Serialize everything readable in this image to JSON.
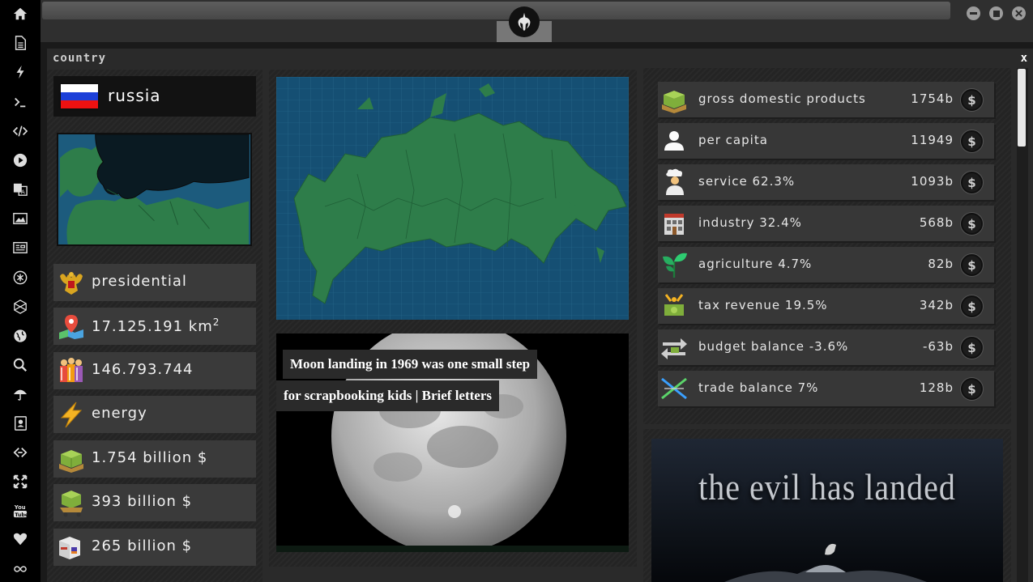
{
  "window": {
    "title": "country",
    "close": "x"
  },
  "country": {
    "name": "russia"
  },
  "profile": [
    {
      "name": "government",
      "icon": "coat-of-arms-icon",
      "value": "presidential"
    },
    {
      "name": "area",
      "icon": "map-pin-icon",
      "value": "17.125.191 km",
      "sup": "2"
    },
    {
      "name": "population",
      "icon": "population-icon",
      "value": "146.793.744"
    },
    {
      "name": "resource",
      "icon": "lightning-icon",
      "value": "energy"
    },
    {
      "name": "gdp-total",
      "icon": "money-stack-icon",
      "value": "1.754 billion $"
    },
    {
      "name": "budget-total",
      "icon": "money-cart-icon",
      "value": "393 billion $"
    },
    {
      "name": "trade-total",
      "icon": "cargo-boxes-icon",
      "value": "265 billion $"
    }
  ],
  "economy": [
    {
      "label": "gross domestic products",
      "value": "1754b",
      "icon": "money-stack-icon"
    },
    {
      "label": "per capita",
      "value": "11949",
      "icon": "person-icon"
    },
    {
      "label": "service 62.3%",
      "value": "1093b",
      "icon": "chef-icon"
    },
    {
      "label": "industry 32.4%",
      "value": "568b",
      "icon": "factory-icon"
    },
    {
      "label": "agriculture 4.7%",
      "value": "82b",
      "icon": "sprout-icon"
    },
    {
      "label": "tax revenue 19.5%",
      "value": "342b",
      "icon": "tax-money-icon"
    },
    {
      "label": "budget balance -3.6%",
      "value": "-63b",
      "icon": "exchange-arrows-icon"
    },
    {
      "label": "trade balance 7%",
      "value": "128b",
      "icon": "trade-cross-icon"
    }
  ],
  "news": {
    "line1": "Moon landing in 1969 was one small step",
    "line2": "for scrapbooking kids | Brief letters"
  },
  "poster": {
    "title": "the evil has landed"
  },
  "colors": {
    "accent_land": "#2e7d4a",
    "ocean": "#154f73",
    "panel": "#242424",
    "row": "#3a3a3a"
  },
  "rail_icons": [
    "home-icon",
    "document-icon",
    "lightning-icon",
    "terminal-icon",
    "code-icon",
    "play-icon",
    "translate-icon",
    "image-icon",
    "newspaper-icon",
    "asterisk-icon",
    "hexagon-icon",
    "globe-icon",
    "search-icon",
    "umbrella-icon",
    "contacts-icon",
    "link-icon",
    "expand-icon",
    "youtube-icon",
    "heart-icon",
    "infinity-icon"
  ]
}
